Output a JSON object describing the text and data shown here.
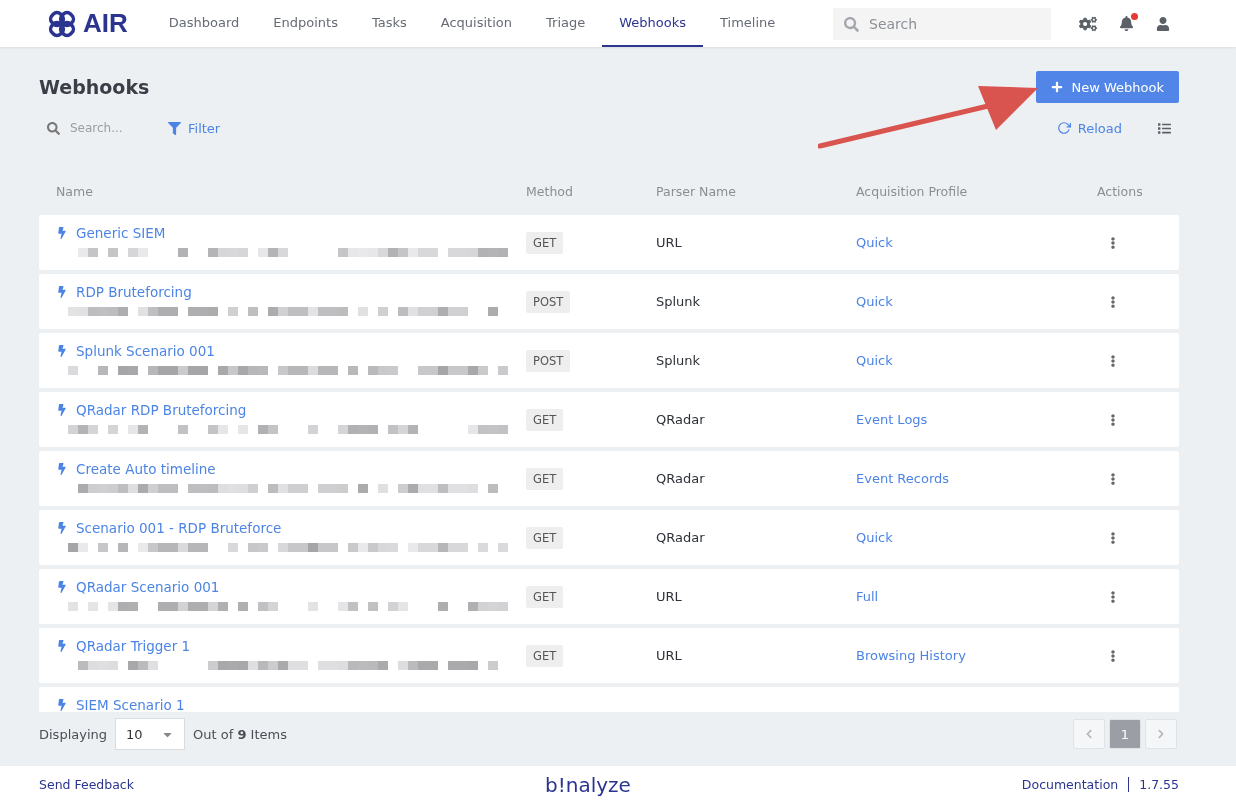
{
  "nav": {
    "logo": "AIR",
    "tabs": [
      {
        "label": "Dashboard",
        "selected": false
      },
      {
        "label": "Endpoints",
        "selected": false
      },
      {
        "label": "Tasks",
        "selected": false
      },
      {
        "label": "Acquisition",
        "selected": false
      },
      {
        "label": "Triage",
        "selected": false
      },
      {
        "label": "Webhooks",
        "selected": true
      },
      {
        "label": "Timeline",
        "selected": false
      }
    ],
    "search": {
      "placeholder": "Search"
    },
    "notifications": {
      "unread": true
    }
  },
  "page": {
    "title": "Webhooks",
    "new_button": "New Webhook",
    "search": {
      "placeholder": "Search..."
    },
    "filter": "Filter",
    "reload": "Reload"
  },
  "table": {
    "columns": [
      "Name",
      "Method",
      "Parser Name",
      "Acquisition Profile",
      "Actions"
    ],
    "rows": [
      {
        "name": "Generic SIEM",
        "method": "GET",
        "parser": "URL",
        "profile": "Quick"
      },
      {
        "name": "RDP Bruteforcing",
        "method": "POST",
        "parser": "Splunk",
        "profile": "Quick"
      },
      {
        "name": "Splunk Scenario 001",
        "method": "POST",
        "parser": "Splunk",
        "profile": "Quick"
      },
      {
        "name": "QRadar RDP Bruteforcing",
        "method": "GET",
        "parser": "QRadar",
        "profile": "Event Logs"
      },
      {
        "name": "Create Auto timeline",
        "method": "GET",
        "parser": "QRadar",
        "profile": "Event Records"
      },
      {
        "name": "Scenario 001 - RDP Bruteforce",
        "method": "GET",
        "parser": "QRadar",
        "profile": "Quick"
      },
      {
        "name": "QRadar Scenario 001",
        "method": "GET",
        "parser": "URL",
        "profile": "Full"
      },
      {
        "name": "QRadar Trigger 1",
        "method": "GET",
        "parser": "URL",
        "profile": "Browsing History"
      },
      {
        "name": "SIEM Scenario 1"
      }
    ]
  },
  "pager": {
    "label": "Displaying",
    "page_size": "10",
    "summary": "Out of **9** Items",
    "pages": [
      {
        "label": "1",
        "selected": true
      }
    ]
  },
  "footer": {
    "feedback": "Send Feedback",
    "brand": "b!nalyze",
    "docs": "Documentation",
    "version": "1.7.55"
  }
}
